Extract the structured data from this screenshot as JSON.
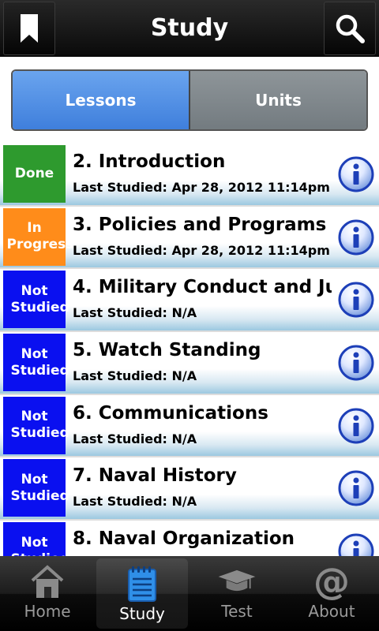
{
  "header": {
    "title": "Study",
    "left_icon": "bookmark-icon",
    "right_icon": "search-icon"
  },
  "segments": {
    "lessons": "Lessons",
    "units": "Units",
    "active": "Lessons"
  },
  "lessons": [
    {
      "title": "2. Introduction",
      "last_studied": "Last Studied: Apr 28, 2012 11:14pm",
      "status": "Done",
      "status_color": "#2e9a2e"
    },
    {
      "title": "3. Policies and Programs",
      "last_studied": "Last Studied: Apr 28, 2012 11:14pm",
      "status": "In Progress",
      "status_color": "#ff8c1a"
    },
    {
      "title": "4. Military Conduct and Ju",
      "last_studied": "Last Studied: N/A",
      "status": "Not Studied",
      "status_color": "#0a10f0"
    },
    {
      "title": "5. Watch Standing",
      "last_studied": "Last Studied: N/A",
      "status": "Not Studied",
      "status_color": "#0a10f0"
    },
    {
      "title": "6. Communications",
      "last_studied": "Last Studied: N/A",
      "status": "Not Studied",
      "status_color": "#0a10f0"
    },
    {
      "title": "7. Naval History",
      "last_studied": "Last Studied: N/A",
      "status": "Not Studied",
      "status_color": "#0a10f0"
    },
    {
      "title": "8. Naval Organization",
      "last_studied": "",
      "status": "Not Studied",
      "status_color": "#0a10f0"
    }
  ],
  "tabs": [
    {
      "label": "Home",
      "icon": "house-icon"
    },
    {
      "label": "Study",
      "icon": "notepad-icon",
      "active": true
    },
    {
      "label": "Test",
      "icon": "graduation-cap-icon"
    },
    {
      "label": "About",
      "icon": "at-sign-icon"
    }
  ]
}
